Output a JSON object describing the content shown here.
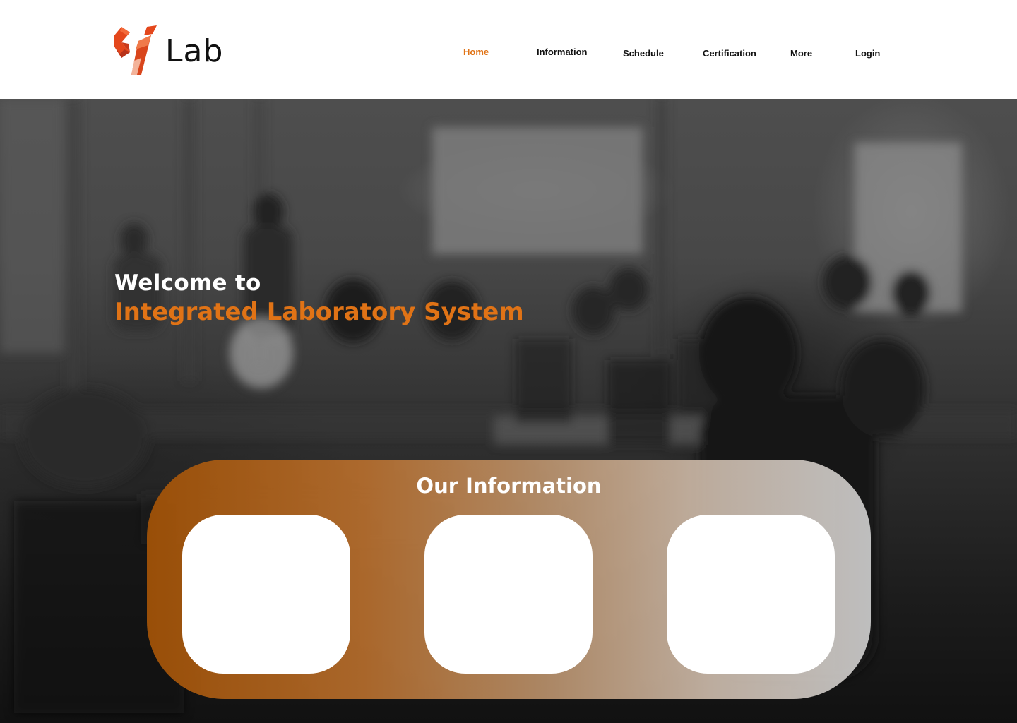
{
  "brand": {
    "name": "Lab",
    "accent_color": "#e07316"
  },
  "nav": {
    "items": [
      {
        "label": "Home",
        "active": true
      },
      {
        "label": "Information",
        "active": false
      },
      {
        "label": "Schedule",
        "active": false
      },
      {
        "label": "Certification",
        "active": false
      },
      {
        "label": "More",
        "active": false
      },
      {
        "label": "Login",
        "active": false
      }
    ]
  },
  "hero": {
    "welcome": "Welcome to",
    "title": "Integrated Laboratory System",
    "background": "blurred-classroom-photo"
  },
  "info": {
    "title": "Our Information",
    "cards": [
      {
        "label": ""
      },
      {
        "label": ""
      },
      {
        "label": ""
      }
    ]
  }
}
